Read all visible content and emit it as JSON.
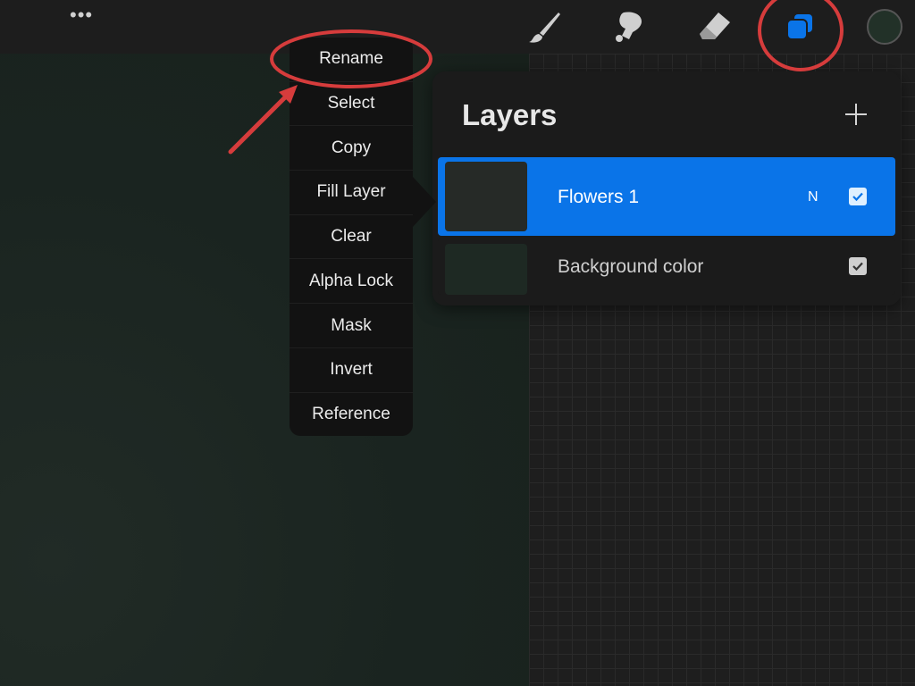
{
  "topbar": {
    "more_icon": "ellipsis-icon",
    "tools": [
      "brush-icon",
      "smudge-icon",
      "eraser-icon",
      "layers-icon",
      "color-swatch"
    ],
    "current_color": "#223128",
    "accent_color": "#0a74e8"
  },
  "layer_menu": {
    "items": [
      {
        "label": "Rename"
      },
      {
        "label": "Select"
      },
      {
        "label": "Copy"
      },
      {
        "label": "Fill Layer"
      },
      {
        "label": "Clear"
      },
      {
        "label": "Alpha Lock"
      },
      {
        "label": "Mask"
      },
      {
        "label": "Invert"
      },
      {
        "label": "Reference"
      }
    ]
  },
  "layers_panel": {
    "title": "Layers",
    "add_icon": "plus-icon",
    "layers": [
      {
        "name": "Flowers 1",
        "blend_mode": "N",
        "visible": true,
        "selected": true
      },
      {
        "name": "Background color",
        "visible": true,
        "selected": false
      }
    ]
  },
  "annotations": {
    "highlight_color": "#d63c3c"
  }
}
